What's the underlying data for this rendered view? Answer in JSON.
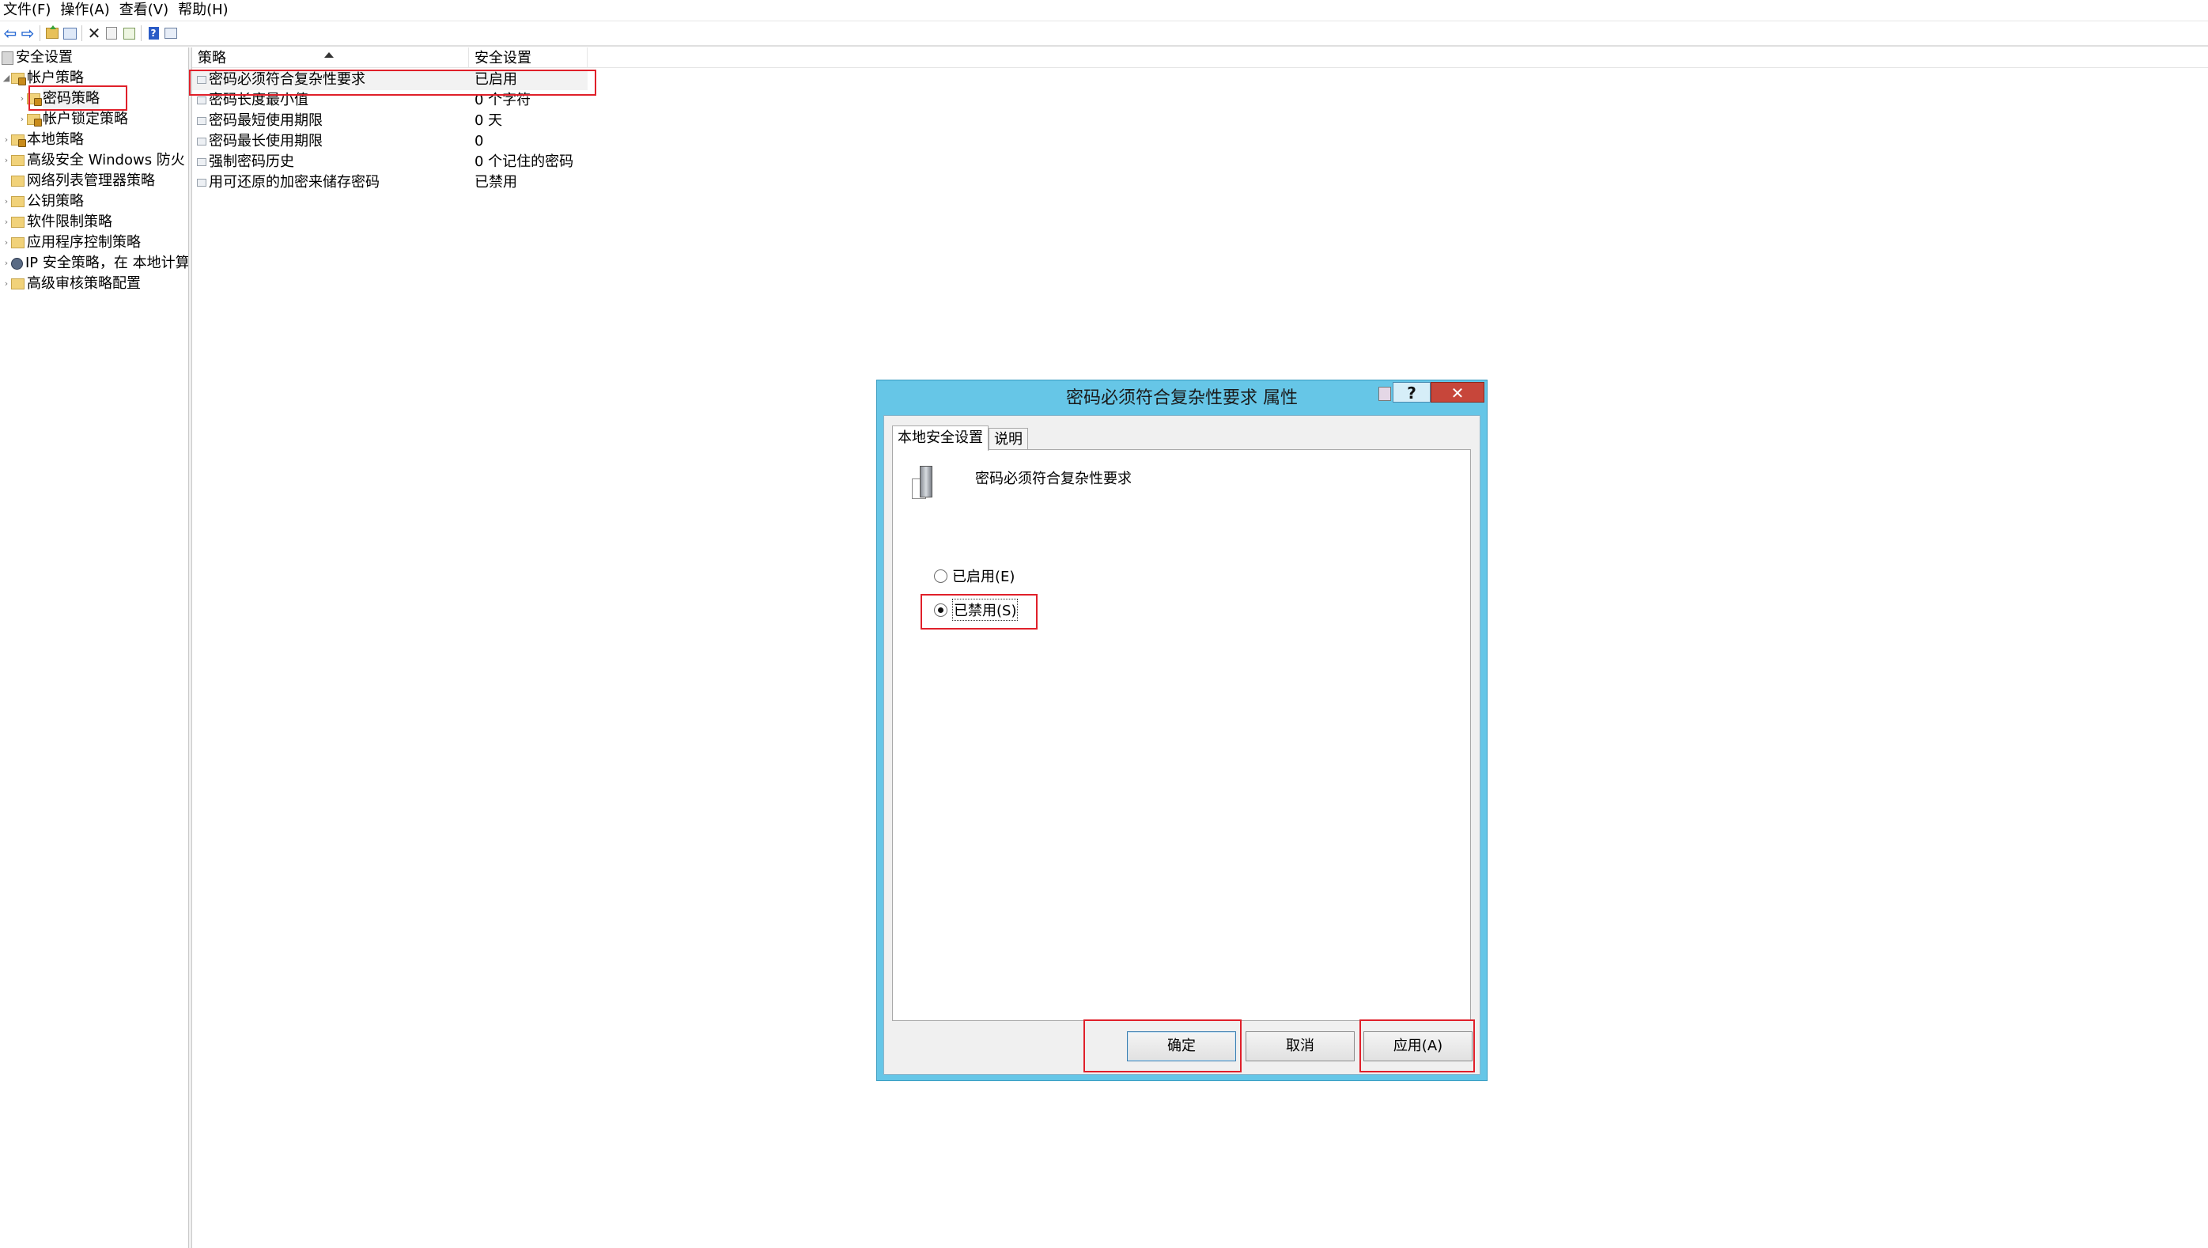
{
  "menu": [
    "文件(F)",
    "操作(A)",
    "查看(V)",
    "帮助(H)"
  ],
  "toolbar": {
    "icons": [
      "back-arrow",
      "forward-arrow",
      "up-folder",
      "show-hide-tree",
      "delete",
      "properties",
      "export-list",
      "help",
      "view"
    ]
  },
  "tree": {
    "root": "安全设置",
    "account_policies": "帐户策略",
    "password_policy": "密码策略",
    "lockout_policy": "帐户锁定策略",
    "local_policies": "本地策略",
    "firewall": "高级安全 Windows 防火",
    "network_list": "网络列表管理器策略",
    "public_key": "公钥策略",
    "software_restriction": "软件限制策略",
    "app_control": "应用程序控制策略",
    "ipsec": "IP 安全策略，在 本地计算",
    "audit": "高级审核策略配置"
  },
  "list": {
    "columns": {
      "policy": "策略",
      "setting": "安全设置"
    },
    "rows": [
      {
        "policy": "密码必须符合复杂性要求",
        "setting": "已启用"
      },
      {
        "policy": "密码长度最小值",
        "setting": "0 个字符"
      },
      {
        "policy": "密码最短使用期限",
        "setting": "0 天"
      },
      {
        "policy": "密码最长使用期限",
        "setting": "0"
      },
      {
        "policy": "强制密码历史",
        "setting": "0 个记住的密码"
      },
      {
        "policy": "用可还原的加密来储存密码",
        "setting": "已禁用"
      }
    ]
  },
  "dialog": {
    "title": "密码必须符合复杂性要求 属性",
    "help_label": "?",
    "close_label": "✕",
    "tabs": {
      "local": "本地安全设置",
      "explain": "说明"
    },
    "policy_name": "密码必须符合复杂性要求",
    "options": {
      "enabled": "已启用(E)",
      "disabled": "已禁用(S)"
    },
    "selected_option": "disabled",
    "buttons": {
      "ok": "确定",
      "cancel": "取消",
      "apply": "应用(A)"
    }
  },
  "colors": {
    "dialog_frame": "#66c6e7",
    "annotation": "#e0202a",
    "close_button": "#c7463a"
  }
}
